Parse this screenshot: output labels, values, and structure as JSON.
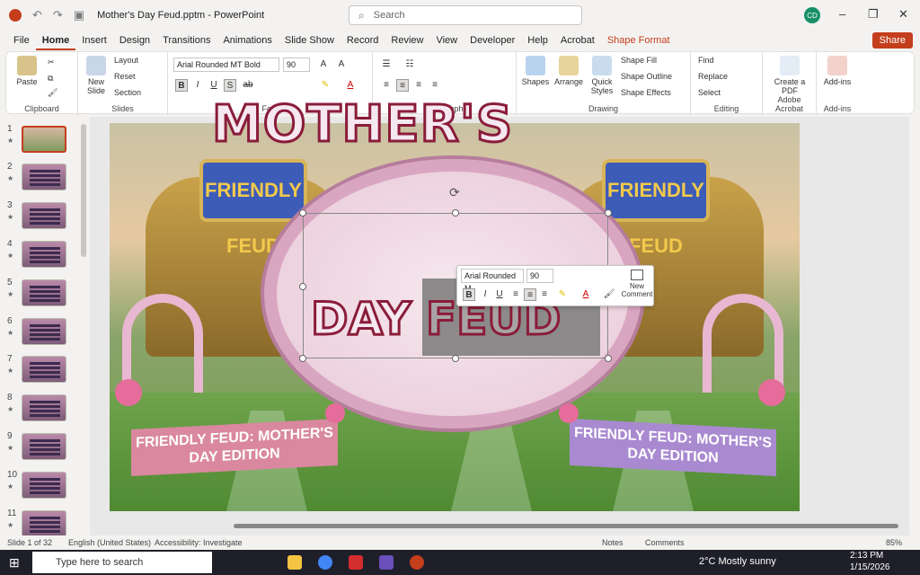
{
  "window": {
    "doc_title": "Mother's Day Feud.pptm - PowerPoint",
    "search_placeholder": "Search",
    "avatar_initials": "CD"
  },
  "menu": {
    "tabs": [
      "File",
      "Home",
      "Insert",
      "Design",
      "Transitions",
      "Animations",
      "Slide Show",
      "Record",
      "Review",
      "View",
      "Developer",
      "Help",
      "Acrobat",
      "Shape Format"
    ],
    "active": "Home",
    "share_label": "Share"
  },
  "ribbon": {
    "clipboard": {
      "paste": "Paste",
      "label": "Clipboard"
    },
    "slides": {
      "new_slide": "New Slide",
      "layout": "Layout",
      "reset": "Reset",
      "section": "Section",
      "label": "Slides"
    },
    "font": {
      "family": "Arial Rounded MT Bold",
      "size": "90",
      "label": "Font"
    },
    "paragraph": {
      "label": "Paragraph"
    },
    "drawing": {
      "shapes": "Shapes",
      "arrange": "Arrange",
      "quick_styles": "Quick Styles",
      "fill": "Shape Fill",
      "outline": "Shape Outline",
      "effects": "Shape Effects",
      "label": "Drawing"
    },
    "editing": {
      "find": "Find",
      "replace": "Replace",
      "select": "Select",
      "label": "Editing"
    },
    "acrobat": {
      "create_pdf": "Create a PDF",
      "label": "Adobe Acrobat"
    },
    "addins": {
      "addins": "Add-ins",
      "label": "Add-ins"
    }
  },
  "thumbnails": [
    "1",
    "2",
    "3",
    "4",
    "5",
    "6",
    "7",
    "8",
    "9",
    "10",
    "11"
  ],
  "slide": {
    "title_line1": "MOTHER'S",
    "title_line2a": "DAY",
    "title_line2b": "FEUD",
    "board_text": "FRIENDLY FEUD",
    "banner_left": "FRIENDLY FEUD: MOTHER'S DAY EDITION",
    "banner_right": "FRIENDLY FEUD: MOTHER'S DAY EDITION"
  },
  "mini_toolbar": {
    "font": "Arial Rounded M",
    "size": "90",
    "new_comment": "New Comment"
  },
  "status": {
    "slide": "Slide 1 of 32",
    "language": "English (United States)",
    "accessibility": "Accessibility: Investigate",
    "notes": "Notes",
    "comments": "Comments",
    "zoom": "85%"
  },
  "taskbar": {
    "search": "Type here to search",
    "weather": "2°C  Mostly sunny",
    "time": "2:13 PM",
    "date": "1/15/2026"
  },
  "colors": {
    "accent": "#c43e1c",
    "title_stroke": "#8a1c3a"
  }
}
